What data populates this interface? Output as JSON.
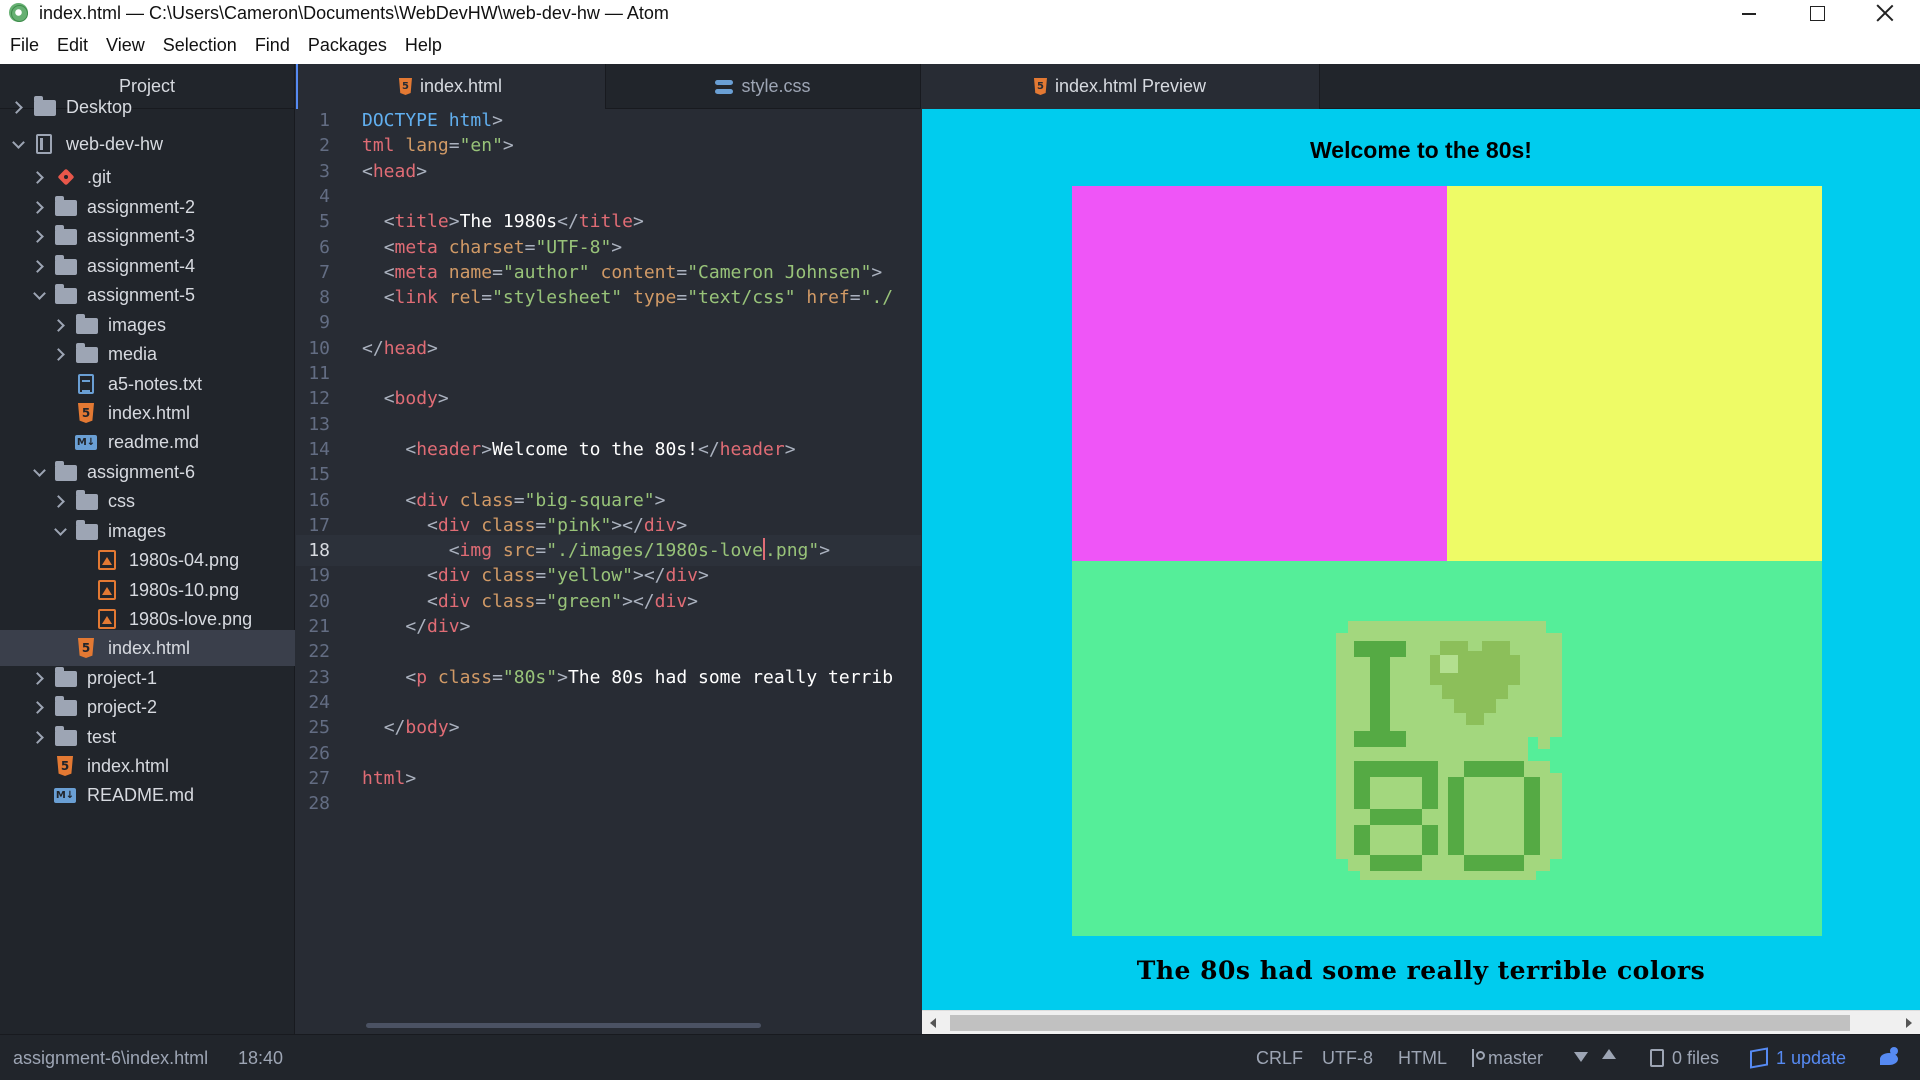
{
  "window": {
    "title": "index.html — C:\\Users\\Cameron\\Documents\\WebDevHW\\web-dev-hw — Atom",
    "app_icon": "atom-icon"
  },
  "menu": [
    "File",
    "Edit",
    "View",
    "Selection",
    "Find",
    "Packages",
    "Help"
  ],
  "sidebar": {
    "title": "Project",
    "items": [
      {
        "label": "Desktop",
        "icon": "folder-icon",
        "state": "collapsed"
      },
      {
        "label": "web-dev-hw",
        "icon": "repo-icon",
        "state": "expanded"
      },
      {
        "label": ".git",
        "icon": "git-icon",
        "state": "collapsed"
      },
      {
        "label": "assignment-2",
        "icon": "folder-icon",
        "state": "collapsed"
      },
      {
        "label": "assignment-3",
        "icon": "folder-icon",
        "state": "collapsed"
      },
      {
        "label": "assignment-4",
        "icon": "folder-icon",
        "state": "collapsed"
      },
      {
        "label": "assignment-5",
        "icon": "folder-icon",
        "state": "expanded"
      },
      {
        "label": "images",
        "icon": "folder-icon",
        "state": "collapsed"
      },
      {
        "label": "media",
        "icon": "folder-icon",
        "state": "collapsed"
      },
      {
        "label": "a5-notes.txt",
        "icon": "text-file-icon"
      },
      {
        "label": "index.html",
        "icon": "html5-icon"
      },
      {
        "label": "readme.md",
        "icon": "markdown-icon"
      },
      {
        "label": "assignment-6",
        "icon": "folder-icon",
        "state": "expanded"
      },
      {
        "label": "css",
        "icon": "folder-icon",
        "state": "collapsed"
      },
      {
        "label": "images",
        "icon": "folder-icon",
        "state": "expanded"
      },
      {
        "label": "1980s-04.png",
        "icon": "image-file-icon"
      },
      {
        "label": "1980s-10.png",
        "icon": "image-file-icon"
      },
      {
        "label": "1980s-love.png",
        "icon": "image-file-icon"
      },
      {
        "label": "index.html",
        "icon": "html5-icon",
        "selected": true
      },
      {
        "label": "project-1",
        "icon": "folder-icon",
        "state": "collapsed"
      },
      {
        "label": "project-2",
        "icon": "folder-icon",
        "state": "collapsed"
      },
      {
        "label": "test",
        "icon": "folder-icon",
        "state": "collapsed"
      },
      {
        "label": "index.html",
        "icon": "html5-icon"
      },
      {
        "label": "README.md",
        "icon": "markdown-icon"
      }
    ]
  },
  "tabs": {
    "editor": [
      {
        "label": "index.html",
        "icon": "html5-icon",
        "active": true
      },
      {
        "label": "style.css",
        "icon": "css3-icon",
        "active": false
      }
    ],
    "preview": {
      "label": "index.html Preview",
      "icon": "html5-icon",
      "active": true
    }
  },
  "editor": {
    "cursor_line": 18,
    "lines": [
      "DOCTYPE html>",
      "tml lang=\"en\">",
      "<head>",
      "",
      "  <title>The 1980s</title>",
      "  <meta charset=\"UTF-8\">",
      "  <meta name=\"author\" content=\"Cameron Johnsen\">",
      "  <link rel=\"stylesheet\" type=\"text/css\" href=\"./",
      "",
      "</head>",
      "",
      "  <body>",
      "",
      "    <header>Welcome to the 80s!</header>",
      "",
      "    <div class=\"big-square\">",
      "      <div class=\"pink\"></div>",
      "        <img src=\"./images/1980s-love.png\">",
      "      <div class=\"yellow\"></div>",
      "      <div class=\"green\"></div>",
      "    </div>",
      "",
      "    <p class=\"80s\">The 80s had some really terrib",
      "",
      "  </body>",
      "",
      "html>",
      ""
    ]
  },
  "preview": {
    "header": "Welcome to the 80s!",
    "paragraph": "The 80s had some really terrible colors",
    "image_text": "I ♥ 80",
    "colors": {
      "background": "#00ccee",
      "pink": "#ef55f7",
      "yellow": "#eefb66",
      "green": "#55ee99"
    }
  },
  "statusbar": {
    "file_path": "assignment-6\\index.html",
    "cursor_pos": "18:40",
    "line_ending": "CRLF",
    "encoding": "UTF-8",
    "grammar": "HTML",
    "branch": "master",
    "changed_files": "0 files",
    "updates": "1 update"
  }
}
